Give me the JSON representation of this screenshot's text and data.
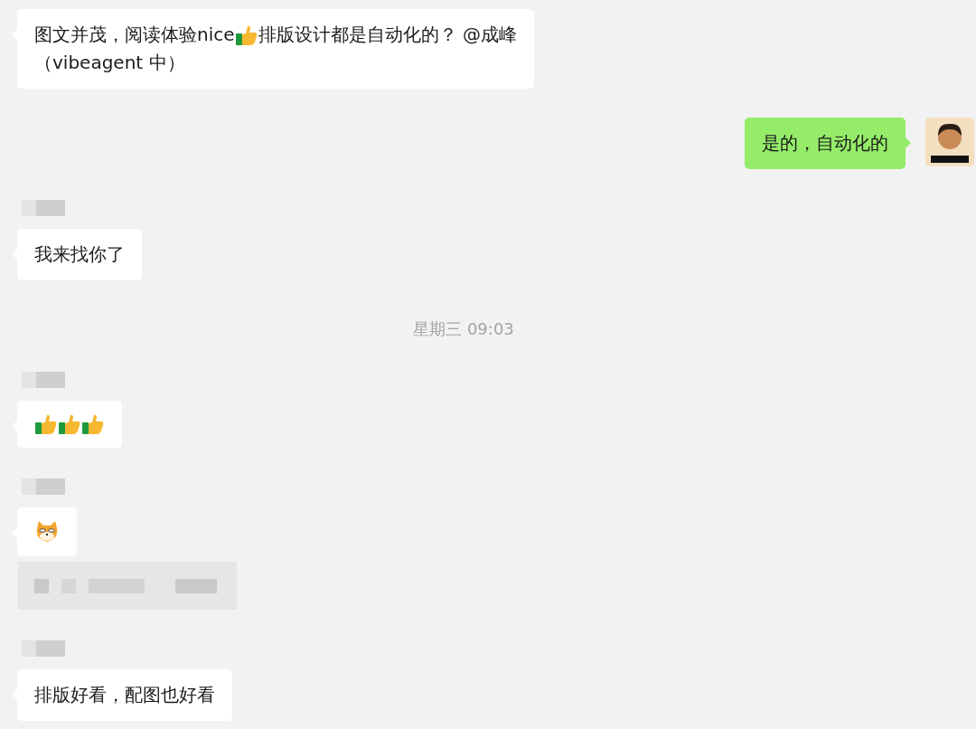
{
  "messages": [
    {
      "kind": "incoming",
      "lines": [
        [
          {
            "kind": "text",
            "text": "图文并茂，阅读体验nice"
          },
          {
            "kind": "thumbs"
          },
          {
            "kind": "text",
            "text": "排版设计都是自动化的？ @成峰"
          }
        ],
        [
          {
            "kind": "text",
            "text": "（vibeagent 中）"
          }
        ]
      ]
    },
    {
      "kind": "outgoing",
      "lines": [
        [
          {
            "kind": "text",
            "text": "是的，自动化的"
          }
        ]
      ]
    },
    {
      "kind": "blurred-name"
    },
    {
      "kind": "incoming",
      "lines": [
        [
          {
            "kind": "text",
            "text": "我来找你了"
          }
        ]
      ]
    },
    {
      "kind": "time",
      "text": "星期三 09:03"
    },
    {
      "kind": "blurred-name"
    },
    {
      "kind": "incoming",
      "lines": [
        [
          {
            "kind": "thumbs"
          },
          {
            "kind": "thumbs"
          },
          {
            "kind": "thumbs"
          }
        ]
      ]
    },
    {
      "kind": "blurred-name"
    },
    {
      "kind": "incoming",
      "lines": [
        [
          {
            "kind": "dog"
          }
        ]
      ]
    },
    {
      "kind": "blurred-card"
    },
    {
      "kind": "blurred-name"
    },
    {
      "kind": "incoming",
      "lines": [
        [
          {
            "kind": "text",
            "text": "排版好看，配图也好看"
          }
        ]
      ]
    }
  ]
}
